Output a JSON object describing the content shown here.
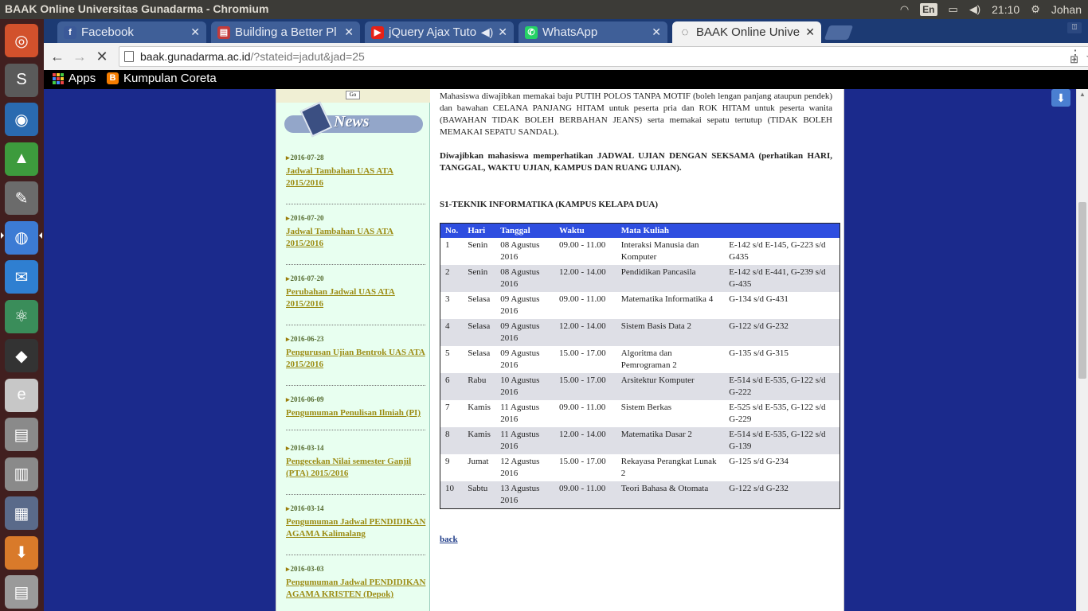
{
  "panel": {
    "window_title": "BAAK Online Universitas Gunadarma - Chromium",
    "keyboard_layout": "En",
    "clock": "21:10",
    "user": "Johan"
  },
  "tabs": [
    {
      "title": "Facebook",
      "favicon": "f",
      "favicon_color": "#3b5998"
    },
    {
      "title": "Building a Better Pl",
      "favicon": "▤",
      "favicon_color": "#c23b3b"
    },
    {
      "title": "jQuery Ajax Tuto",
      "favicon": "▶",
      "favicon_color": "#e62117"
    },
    {
      "title": "WhatsApp",
      "favicon": "✆",
      "favicon_color": "#25d366"
    },
    {
      "title": "BAAK Online Unive",
      "favicon": "◌",
      "favicon_color": "#333333"
    }
  ],
  "omnibox": {
    "host": "baak.gunadarma.ac.id",
    "path": "/?stateid=jadut&jad=25"
  },
  "bookmarks": {
    "apps": "Apps",
    "kumpulan": "Kumpulan Coreta"
  },
  "sidebar": {
    "go_label": "Go",
    "news_label": "News",
    "items": [
      {
        "date": "2016-07-28",
        "title": "Jadwal Tambahan UAS ATA 2015/2016"
      },
      {
        "date": "2016-07-20",
        "title": "Jadwal Tambahan UAS ATA 2015/2016"
      },
      {
        "date": "2016-07-20",
        "title": "Perubahan Jadwal UAS ATA 2015/2016"
      },
      {
        "date": "2016-06-23",
        "title": "Pengurusan Ujian Bentrok UAS ATA 2015/2016"
      },
      {
        "date": "2016-06-09",
        "title": "Pengumuman Penulisan Ilmiah (PI)"
      },
      {
        "date": "2016-03-14",
        "title": "Pengecekan Nilai semester Ganjil (PTA) 2015/2016"
      },
      {
        "date": "2016-03-14",
        "title": "Pengumuman Jadwal PENDIDIKAN AGAMA Kalimalang"
      },
      {
        "date": "2016-03-03",
        "title": "Pengumuman Jadwal PENDIDIKAN AGAMA KRISTEN (Depok)"
      }
    ]
  },
  "content": {
    "intro": "Mahasiswa diwajibkan memakai baju PUTIH POLOS TANPA MOTIF (boleh lengan panjang ataupun pendek) dan bawahan CELANA PANJANG HITAM untuk peserta pria dan ROK HITAM untuk peserta wanita (BAWAHAN TIDAK BOLEH BERBAHAN JEANS) serta memakai sepatu tertutup (TIDAK BOLEH MEMAKAI SEPATU SANDAL).",
    "notice": "Diwajibkan mahasiswa memperhatikan JADWAL UJIAN DENGAN SEKSAMA (perhatikan HARI, TANGGAL, WAKTU UJIAN, KAMPUS DAN RUANG UJIAN).",
    "program": "S1-TEKNIK INFORMATIKA (KAMPUS KELAPA DUA)",
    "back": "back"
  },
  "schedule": {
    "headers": [
      "No.",
      "Hari",
      "Tanggal",
      "Waktu",
      "Mata Kuliah",
      ""
    ],
    "rows": [
      [
        "1",
        "Senin",
        "08 Agustus 2016",
        "09.00 - 11.00",
        "Interaksi Manusia dan Komputer",
        "E-142 s/d E-145, G-223 s/d G435"
      ],
      [
        "2",
        "Senin",
        "08 Agustus 2016",
        "12.00 - 14.00",
        "Pendidikan Pancasila",
        "E-142 s/d E-441, G-239 s/d G-435"
      ],
      [
        "3",
        "Selasa",
        "09 Agustus 2016",
        "09.00 - 11.00",
        "Matematika Informatika 4",
        "G-134 s/d G-431"
      ],
      [
        "4",
        "Selasa",
        "09 Agustus 2016",
        "12.00 - 14.00",
        "Sistem Basis Data 2",
        "G-122 s/d G-232"
      ],
      [
        "5",
        "Selasa",
        "09 Agustus 2016",
        "15.00 - 17.00",
        "Algoritma dan Pemrograman 2",
        "G-135 s/d G-315"
      ],
      [
        "6",
        "Rabu",
        "10 Agustus 2016",
        "15.00 - 17.00",
        "Arsitektur Komputer",
        "E-514 s/d E-535, G-122 s/d G-222"
      ],
      [
        "7",
        "Kamis",
        "11 Agustus 2016",
        "09.00 - 11.00",
        "Sistem Berkas",
        "E-525 s/d E-535, G-122 s/d G-229"
      ],
      [
        "8",
        "Kamis",
        "11 Agustus 2016",
        "12.00 - 14.00",
        "Matematika Dasar 2",
        "E-514 s/d E-535, G-122 s/d G-139"
      ],
      [
        "9",
        "Jumat",
        "12 Agustus 2016",
        "15.00 - 17.00",
        "Rekayasa Perangkat Lunak 2",
        "G-125 s/d G-234"
      ],
      [
        "10",
        "Sabtu",
        "13 Agustus 2016",
        "09.00 - 11.00",
        "Teori Bahasa & Otomata",
        "G-122 s/d G-232"
      ]
    ]
  },
  "launcher": [
    {
      "name": "ubuntu-dash-icon",
      "glyph": "◎",
      "color": "#d2512c"
    },
    {
      "name": "sublime-text-icon",
      "glyph": "S",
      "color": "#5a5a5a"
    },
    {
      "name": "firefox-icon",
      "glyph": "◉",
      "color": "#2a6ab0"
    },
    {
      "name": "android-studio-icon",
      "glyph": "▲",
      "color": "#3d9b3d"
    },
    {
      "name": "text-editor-icon",
      "glyph": "✎",
      "color": "#6b6b6b"
    },
    {
      "name": "chromium-icon",
      "glyph": "◍",
      "color": "#3c7bd4"
    },
    {
      "name": "thunderbird-icon",
      "glyph": "✉",
      "color": "#2f7fd1"
    },
    {
      "name": "atom-icon",
      "glyph": "⚛",
      "color": "#3a8d5a"
    },
    {
      "name": "unity-icon",
      "glyph": "◆",
      "color": "#333333"
    },
    {
      "name": "app-red-icon",
      "glyph": "e",
      "color": "#c7c7c7"
    },
    {
      "name": "files-icon",
      "glyph": "▤",
      "color": "#8a8a8a"
    },
    {
      "name": "software-icon",
      "glyph": "▥",
      "color": "#8a8a8a"
    },
    {
      "name": "scanner-icon",
      "glyph": "▦",
      "color": "#5a6a8a"
    },
    {
      "name": "installer-icon",
      "glyph": "⬇",
      "color": "#d97a2a"
    },
    {
      "name": "printer-icon",
      "glyph": "▤",
      "color": "#9a9a9a"
    }
  ]
}
